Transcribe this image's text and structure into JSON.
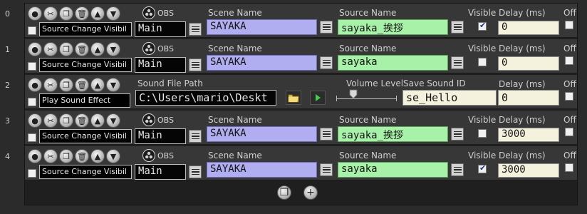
{
  "row_numbers": [
    "0",
    "1",
    "2",
    "3",
    "4"
  ],
  "labels": {
    "obs": "OBS",
    "scene_name": "Scene Name",
    "source_name": "Source Name",
    "visible": "Visible",
    "delay": "Delay (ms)",
    "off": "Off",
    "sound_file_path": "Sound File Path",
    "volume_level": "Volume Level",
    "save_sound_id": "Save Sound ID"
  },
  "rows": [
    {
      "type": "obs",
      "action": "Source Change Visibil",
      "scene_collection": "Main",
      "scene": "SAYAKA",
      "source": "sayaka_挨拶",
      "visible": true,
      "delay": "0",
      "off": false,
      "enabled": false
    },
    {
      "type": "obs",
      "action": "Source Change Visibil",
      "scene_collection": "Main",
      "scene": "SAYAKA",
      "source": "sayaka",
      "visible": false,
      "delay": "0",
      "off": false,
      "enabled": false
    },
    {
      "type": "sound",
      "action": "Play Sound Effect",
      "path": "C:\\Users\\mario\\Deskt",
      "volume": 0.3,
      "sound_id": "se_Hello",
      "delay": "0",
      "off": false,
      "enabled": false
    },
    {
      "type": "obs",
      "action": "Source Change Visibil",
      "scene_collection": "Main",
      "scene": "SAYAKA",
      "source": "sayaka_挨拶",
      "visible": false,
      "delay": "3000",
      "off": false,
      "enabled": false
    },
    {
      "type": "obs",
      "action": "Source Change Visibil",
      "scene_collection": "Main",
      "scene": "SAYAKA",
      "source": "sayaka",
      "visible": true,
      "delay": "3000",
      "off": false,
      "enabled": false
    }
  ],
  "icons": {
    "row_toolbar": [
      "record-icon",
      "cut-icon",
      "paste-icon",
      "delete-icon",
      "move-up-icon",
      "move-down-icon"
    ],
    "footer": [
      "paste-icon",
      "add-icon"
    ]
  },
  "colors": {
    "scene_field": "#b0aef0",
    "source_field": "#a7f2a8",
    "delay_field": "#f4f1dc"
  }
}
